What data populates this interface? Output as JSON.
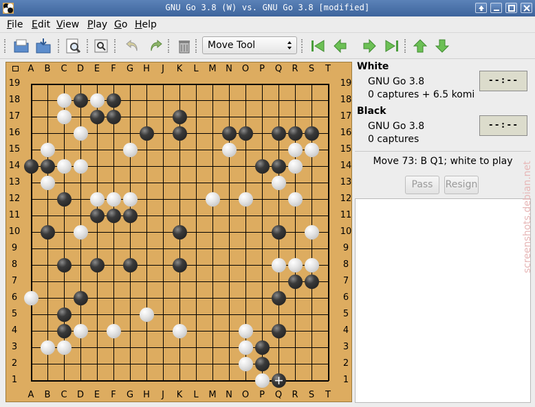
{
  "window": {
    "title": "GNU Go 3.8 (W) vs. GNU Go 3.8 [modified]"
  },
  "menu": {
    "items": [
      {
        "u": "F",
        "rest": "ile"
      },
      {
        "u": "E",
        "rest": "dit"
      },
      {
        "u": "V",
        "rest": "iew"
      },
      {
        "u": "P",
        "rest": "lay"
      },
      {
        "u": "G",
        "rest": "o"
      },
      {
        "u": "H",
        "rest": "elp"
      }
    ]
  },
  "toolbar": {
    "tool_select_value": "Move Tool"
  },
  "board": {
    "columns": [
      "A",
      "B",
      "C",
      "D",
      "E",
      "F",
      "G",
      "H",
      "J",
      "K",
      "L",
      "M",
      "N",
      "O",
      "P",
      "Q",
      "R",
      "S",
      "T"
    ],
    "rows": [
      "19",
      "18",
      "17",
      "16",
      "15",
      "14",
      "13",
      "12",
      "11",
      "10",
      "9",
      "8",
      "7",
      "6",
      "5",
      "4",
      "3",
      "2",
      "1"
    ],
    "black": [
      "D18",
      "F18",
      "E17",
      "F17",
      "K17",
      "H16",
      "K16",
      "N16",
      "O16",
      "Q16",
      "R16",
      "S16",
      "A14",
      "B14",
      "P14",
      "Q14",
      "C12",
      "E11",
      "F11",
      "G11",
      "B10",
      "K10",
      "Q10",
      "C8",
      "E8",
      "G8",
      "K8",
      "R7",
      "S7",
      "D6",
      "Q6",
      "C5",
      "C4",
      "Q4",
      "P3",
      "P2",
      "Q1"
    ],
    "white": [
      "C18",
      "E18",
      "C17",
      "D16",
      "N15",
      "B15",
      "G15",
      "R15",
      "S15",
      "C14",
      "D14",
      "R14",
      "B13",
      "Q13",
      "E12",
      "F12",
      "G12",
      "M12",
      "O12",
      "R12",
      "D10",
      "S10",
      "Q8",
      "R8",
      "S8",
      "A6",
      "H5",
      "D4",
      "F4",
      "K4",
      "O4",
      "B3",
      "C3",
      "O3",
      "O2",
      "P1"
    ],
    "last_move": "Q1",
    "colors": {
      "wood": "#ddac60"
    }
  },
  "panel": {
    "white": {
      "label": "White",
      "engine": "GNU Go 3.8",
      "captures": "0 captures + 6.5 komi",
      "clock": "--:--"
    },
    "black": {
      "label": "Black",
      "engine": "GNU Go 3.8",
      "captures": "0 captures",
      "clock": "--:--"
    },
    "status": "Move 73: B Q1; white to play",
    "pass_label": "Pass",
    "resign_label": "Resign"
  },
  "watermark": "screenshots.debian.net"
}
